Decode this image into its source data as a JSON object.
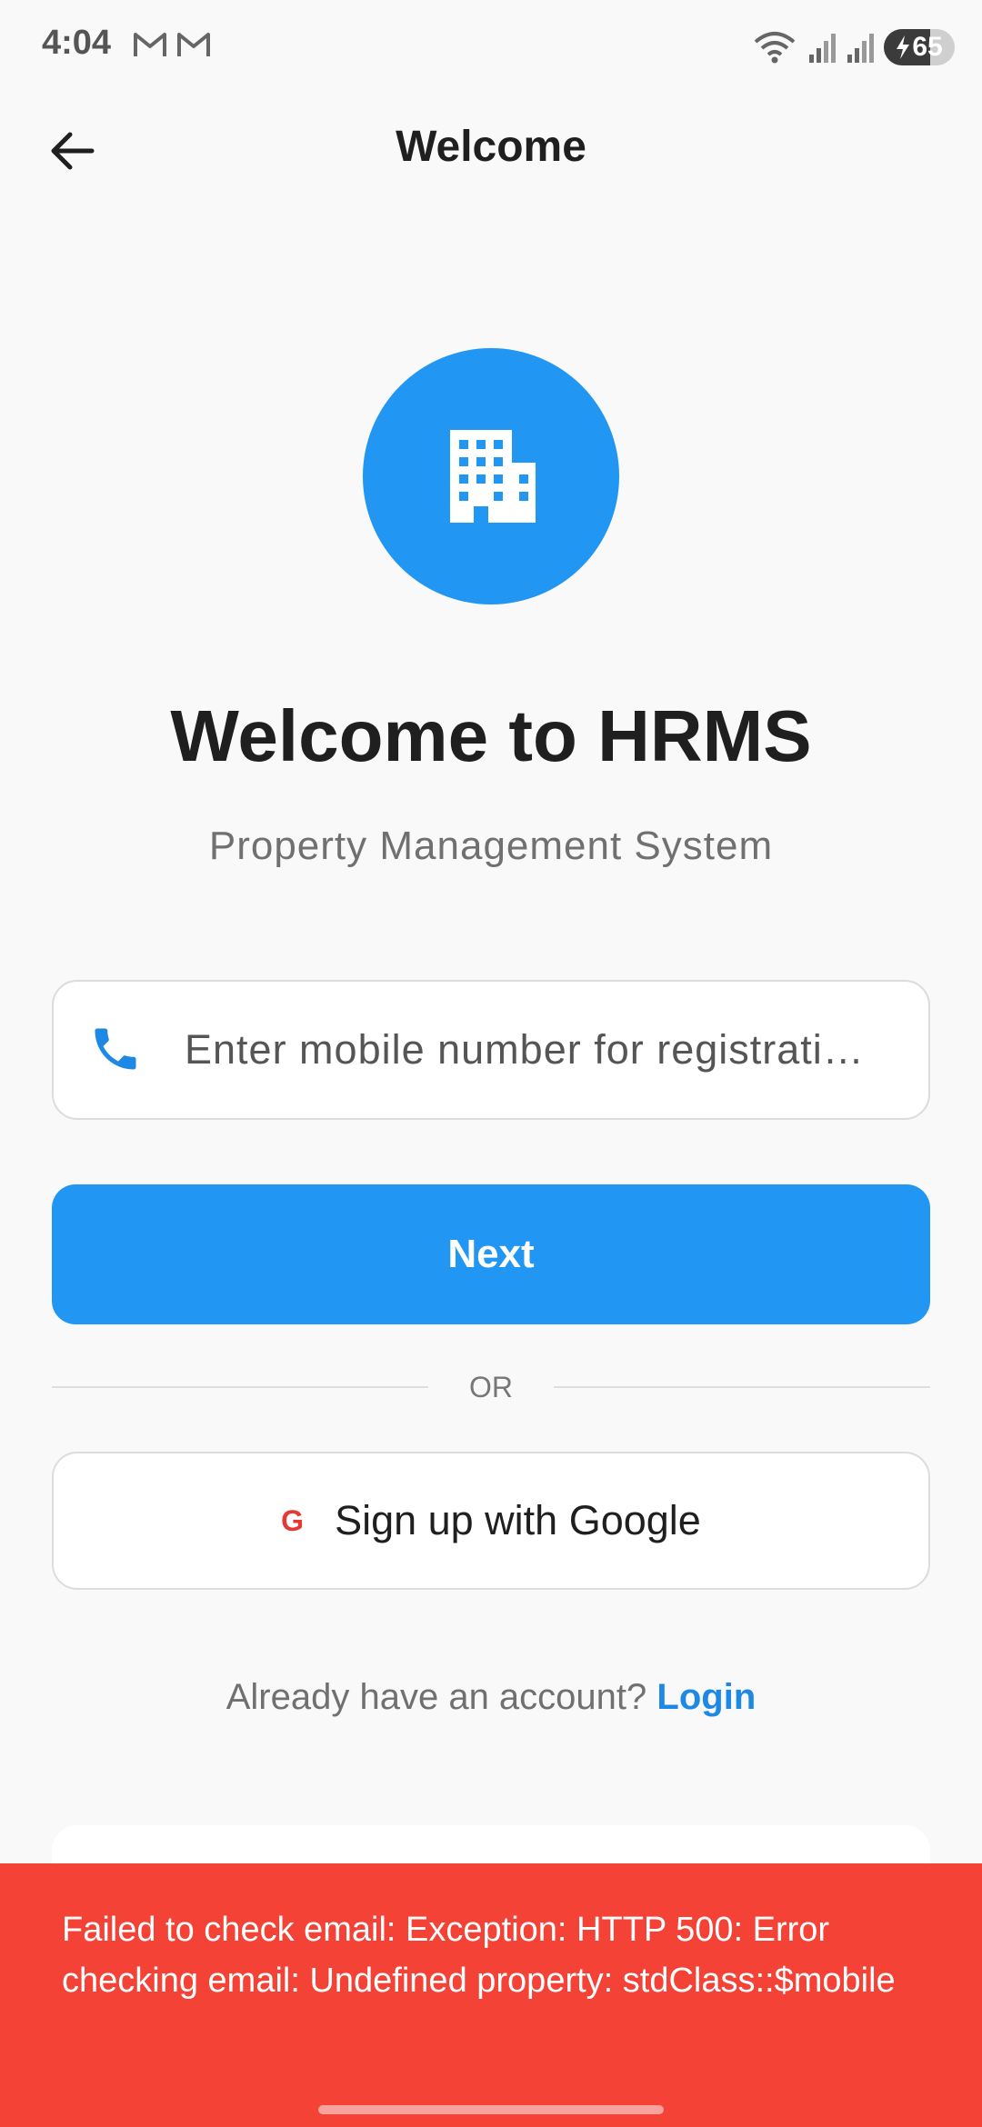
{
  "status_bar": {
    "time": "4:04",
    "notification_icons": [
      "gmail-icon",
      "gmail-icon"
    ],
    "system_icons": [
      "wifi-icon",
      "signal-icon",
      "signal-icon"
    ],
    "battery_level": "65",
    "battery_fraction": 0.65,
    "battery_charging": true
  },
  "app_bar": {
    "title": "Welcome",
    "back_icon": "arrow-left-icon"
  },
  "logo": {
    "icon": "building-icon",
    "color": "#2196f3"
  },
  "headline": "Welcome to HRMS",
  "subtitle": "Property Management System",
  "mobile_input": {
    "icon": "phone-icon",
    "placeholder": "Enter mobile number for registrati…",
    "value": ""
  },
  "next_button": {
    "label": "Next",
    "color": "#2196f3"
  },
  "divider": {
    "label": "OR"
  },
  "google_button": {
    "icon_text": "G",
    "label": "Sign up with Google"
  },
  "login_prompt": {
    "text": "Already have an account?",
    "link": "Login"
  },
  "error_snackbar": {
    "message": "Failed to check email: Exception: HTTP 500: Error checking email: Undefined property: stdClass::$mobile",
    "color": "#f44336"
  }
}
